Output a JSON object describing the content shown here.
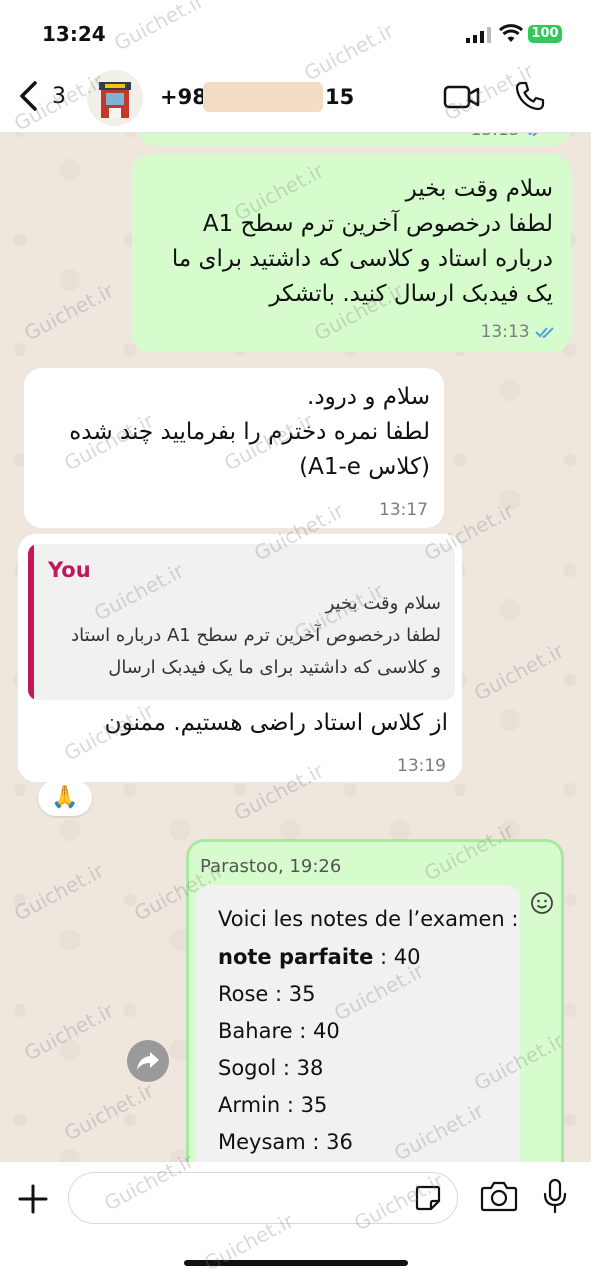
{
  "status_bar": {
    "time": "13:24",
    "battery": "100"
  },
  "header": {
    "back_count": "3",
    "phone_prefix": "+98",
    "phone_suffix": "15"
  },
  "messages": [
    {
      "type": "outgoing",
      "time": "13:13"
    },
    {
      "type": "outgoing",
      "lines": [
        "سلام وقت بخیر",
        "لطفا درخصوص آخرین ترم سطح A1",
        "درباره استاد و کلاسی که داشتید برای ما",
        "یک فیدبک ارسال کنید. باتشکر"
      ],
      "time": "13:13"
    },
    {
      "type": "incoming",
      "lines": [
        "سلام و درود.",
        "لطفا نمره دخترم را بفرمایید چند شده",
        "(کلاس A1-e)"
      ],
      "time": "13:17"
    },
    {
      "type": "incoming_reply",
      "quote_author": "You",
      "quote_lines": [
        "سلام وقت بخیر",
        "لطفا درخصوص آخرین ترم سطح A1 درباره استاد",
        "و کلاسی که داشتید برای ما یک فیدبک ارسال"
      ],
      "text": "از کلاس استاد راضی هستیم. ممنون",
      "time": "13:19",
      "reaction": "🙏"
    },
    {
      "type": "outgoing_forward",
      "sender": "Parastoo, 19:26",
      "notes_title": "Voici les notes de l’examen :",
      "notes": [
        {
          "name": "note parfaite",
          "sep": " : ",
          "score": "40",
          "bold": true
        },
        {
          "name": "Rose",
          "sep": " : ",
          "score": "35"
        },
        {
          "name": "Bahare",
          "sep": " : ",
          "score": "40"
        },
        {
          "name": "Sogol",
          "sep": " : ",
          "score": "38"
        },
        {
          "name": "Armin",
          "sep": " : ",
          "score": "35"
        },
        {
          "name": "Meysam",
          "sep": " : ",
          "score": "36"
        }
      ]
    }
  ],
  "watermark": "Guichet.ir",
  "composer": {
    "placeholder": ""
  },
  "colors": {
    "outgoing": "#d6fccd",
    "incoming": "#ffffff",
    "quote_accent": "#c2185b",
    "tick": "#4fa3e0",
    "battery": "#34c759"
  }
}
